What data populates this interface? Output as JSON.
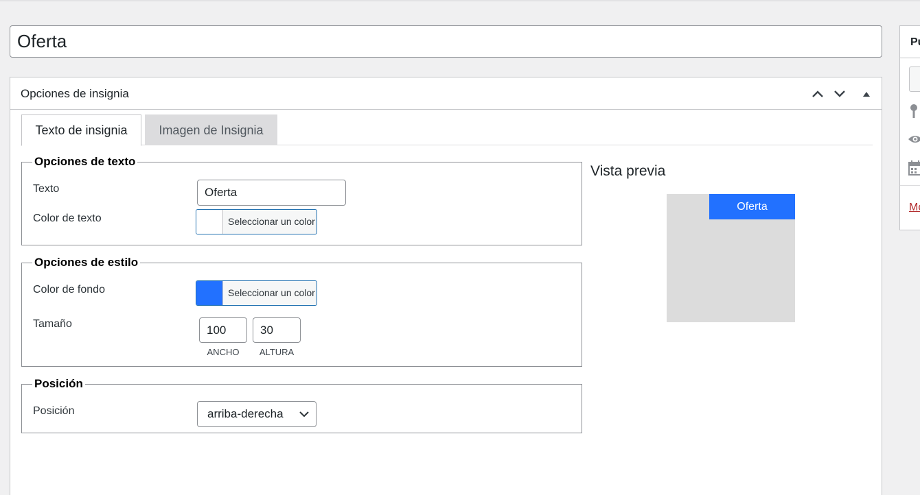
{
  "post": {
    "title": "Oferta"
  },
  "metabox": {
    "title": "Opciones de insignia",
    "tabs": [
      {
        "label": "Texto de insignia",
        "active": true
      },
      {
        "label": "Imagen de Insignia",
        "active": false
      }
    ]
  },
  "text_options": {
    "legend": "Opciones de texto",
    "text_label": "Texto",
    "text_value": "Oferta",
    "color_label": "Color de texto",
    "color_value": "#ffffff",
    "color_button": "Seleccionar un color"
  },
  "style_options": {
    "legend": "Opciones de estilo",
    "bg_label": "Color de fondo",
    "bg_value": "#2271ff",
    "color_button": "Seleccionar un color",
    "size_label": "Tamaño",
    "width_value": "100",
    "width_label": "ANCHO",
    "height_value": "30",
    "height_label": "ALTURA"
  },
  "position_options": {
    "legend": "Posición",
    "label": "Posición",
    "selected": "arriba-derecha"
  },
  "preview": {
    "title": "Vista previa",
    "badge_text": "Oferta",
    "badge_bg": "#2271ff",
    "badge_color": "#ffffff",
    "box_bg": "#dcdcdc"
  },
  "sidebar": {
    "title": "Pu",
    "link": "Mo",
    "icons": [
      "pin-icon",
      "eye-icon",
      "calendar-icon"
    ]
  }
}
